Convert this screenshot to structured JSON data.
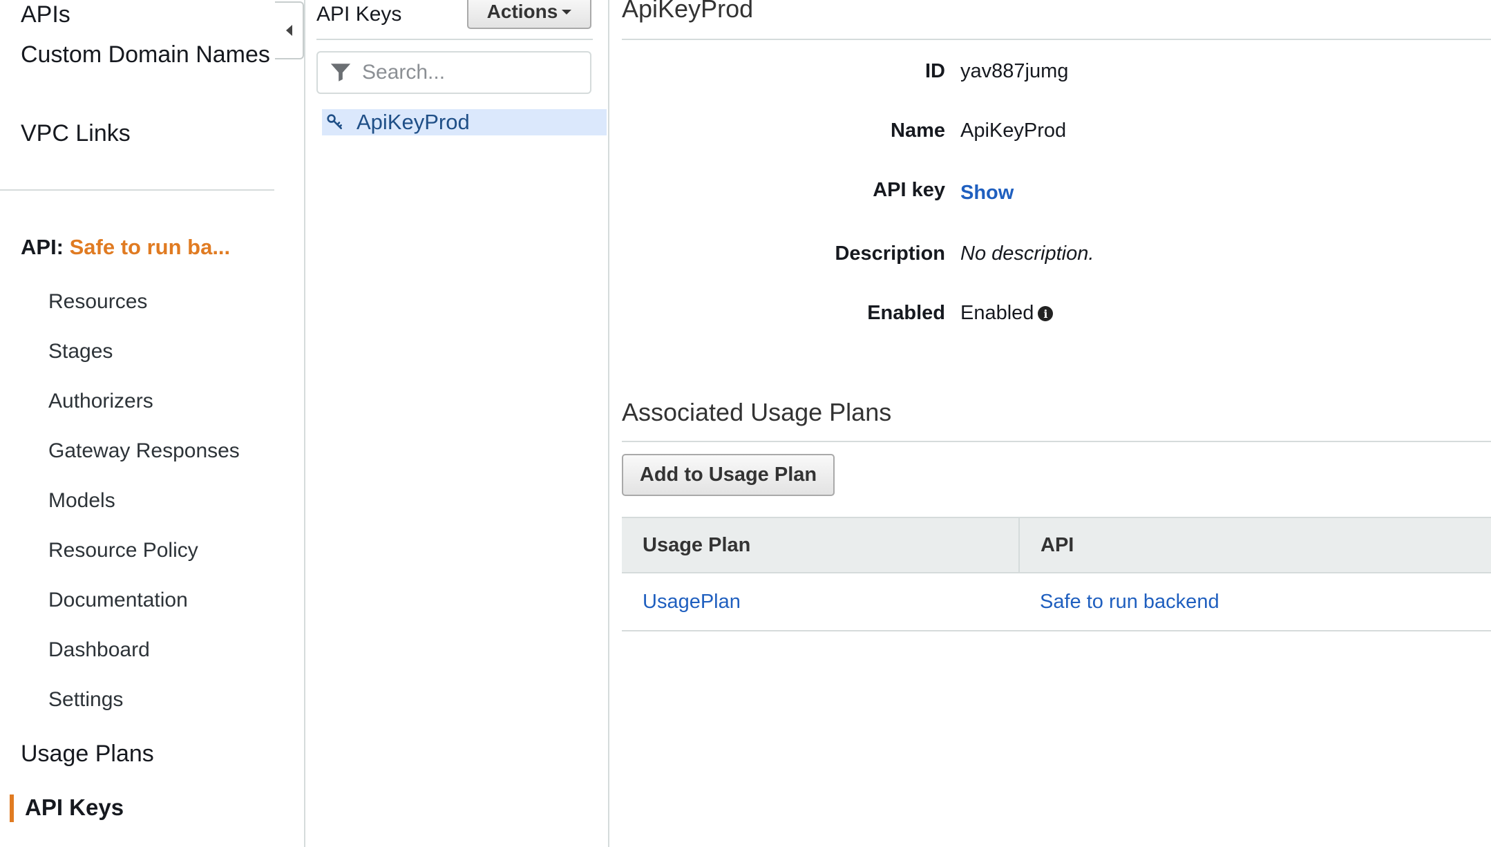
{
  "nav": {
    "top_items": [
      "APIs",
      "Custom Domain Names",
      "VPC Links"
    ],
    "api_prefix": "API:",
    "api_name": "Safe to run ba...",
    "api_sub_items": [
      "Resources",
      "Stages",
      "Authorizers",
      "Gateway Responses",
      "Models",
      "Resource Policy",
      "Documentation",
      "Dashboard",
      "Settings"
    ],
    "usage_plans": "Usage Plans",
    "api_keys": "API Keys"
  },
  "keys_panel": {
    "title": "API Keys",
    "actions_label": "Actions",
    "search_placeholder": "Search...",
    "items": [
      {
        "label": "ApiKeyProd",
        "selected": true
      }
    ]
  },
  "detail": {
    "title": "ApiKeyProd",
    "fields": [
      {
        "label": "ID",
        "value": "yav887jumg"
      },
      {
        "label": "Name",
        "value": "ApiKeyProd"
      },
      {
        "label": "API key",
        "value": "Show"
      },
      {
        "label": "Description",
        "value": "No description."
      },
      {
        "label": "Enabled",
        "value": "Enabled"
      }
    ],
    "usage_section_title": "Associated Usage Plans",
    "add_button_label": "Add to Usage Plan",
    "table": {
      "headers": [
        "Usage Plan",
        "API"
      ],
      "rows": [
        [
          "UsagePlan",
          "Safe to run backend"
        ]
      ]
    }
  },
  "colors": {
    "accent_orange": "#e07b22",
    "link_blue": "#1f5fbf",
    "selected_bg": "#dbe8fc"
  }
}
